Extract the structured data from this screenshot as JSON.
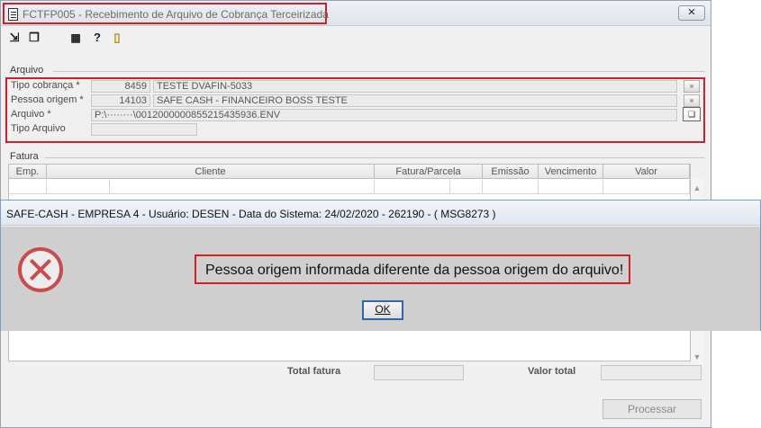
{
  "window": {
    "title": "FCTFP005 - Recebimento de Arquivo de Cobrança Terceirizada",
    "close_label": "✕"
  },
  "toolbar": {
    "icons": [
      "arrow-exit-icon",
      "copy-icon",
      "grid-icon",
      "help-icon",
      "door-exit-icon"
    ]
  },
  "arquivo": {
    "group_label": "Arquivo",
    "tipo_cobranca_label": "Tipo cobrança *",
    "tipo_cobranca_code": "8459",
    "tipo_cobranca_desc": "TESTE DVAFIN-5033",
    "pessoa_origem_label": "Pessoa origem *",
    "pessoa_origem_code": "14103",
    "pessoa_origem_desc": "SAFE CASH - FINANCEIRO BOSS TESTE",
    "arquivo_label": "Arquivo *",
    "arquivo_path": "P:\\········\\0012000000855215435936.ENV",
    "tipo_arquivo_label": "Tipo Arquivo",
    "tipo_arquivo_value": ""
  },
  "fatura": {
    "group_label": "Fatura",
    "columns": [
      "Emp.",
      "Cliente",
      "Fatura/Parcela",
      "Emissão",
      "Vencimento",
      "Valor"
    ]
  },
  "totals": {
    "total_fatura_label": "Total fatura",
    "valor_total_label": "Valor total"
  },
  "actions": {
    "processar_label": "Processar"
  },
  "dialog": {
    "title": "SAFE-CASH - EMPRESA 4 - Usuário: DESEN - Data do Sistema: 24/02/2020 - 262190 - ( MSG8273 )",
    "message": "Pessoa origem informada diferente da pessoa origem do arquivo!",
    "ok_label": "OK",
    "icon": "error-icon"
  },
  "colors": {
    "highlight": "#d0202a",
    "error_icon": "#c94b4b",
    "focus_border": "#2f66b0"
  }
}
